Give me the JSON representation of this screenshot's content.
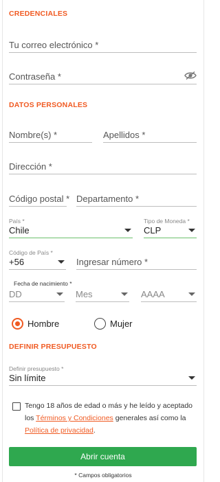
{
  "credentials": {
    "title": "CREDENCIALES",
    "email_placeholder": "Tu correo electrónico *",
    "password_placeholder": "Contraseña *"
  },
  "personal": {
    "title": "DATOS PERSONALES",
    "name_placeholder": "Nombre(s) *",
    "lastname_placeholder": "Apellidos *",
    "address_placeholder": "Dirección *",
    "postal_placeholder": "Código postal *",
    "department_placeholder": "Departamento *",
    "country_label": "País *",
    "country_value": "Chile",
    "currency_label": "Tipo de Moneda *",
    "currency_value": "CLP",
    "country_code_label": "Código de País *",
    "country_code_value": "+56",
    "phone_placeholder": "Ingresar número *",
    "dob_label": "Fecha de nacimiento *",
    "dob_day": "DD",
    "dob_month": "Mes",
    "dob_year": "AAAA",
    "gender_male": "Hombre",
    "gender_female": "Mujer",
    "gender_selected": "Hombre"
  },
  "budget": {
    "title": "DEFINIR PRESUPUESTO",
    "label": "Definir presupuesto *",
    "value": "Sin límite"
  },
  "terms": {
    "text_before": "Tengo 18 años de edad o más y he leído y aceptado los ",
    "terms_link": "Términos y Condiciones",
    "text_middle": " generales así como la ",
    "privacy_link": "Política de privacidad",
    "text_after": "."
  },
  "submit_label": "Abrir cuenta",
  "required_note": "* Campos obligatorios",
  "colors": {
    "accent": "#f05a22",
    "button": "#2fa84f",
    "select_underline": "#6bbf6b"
  }
}
